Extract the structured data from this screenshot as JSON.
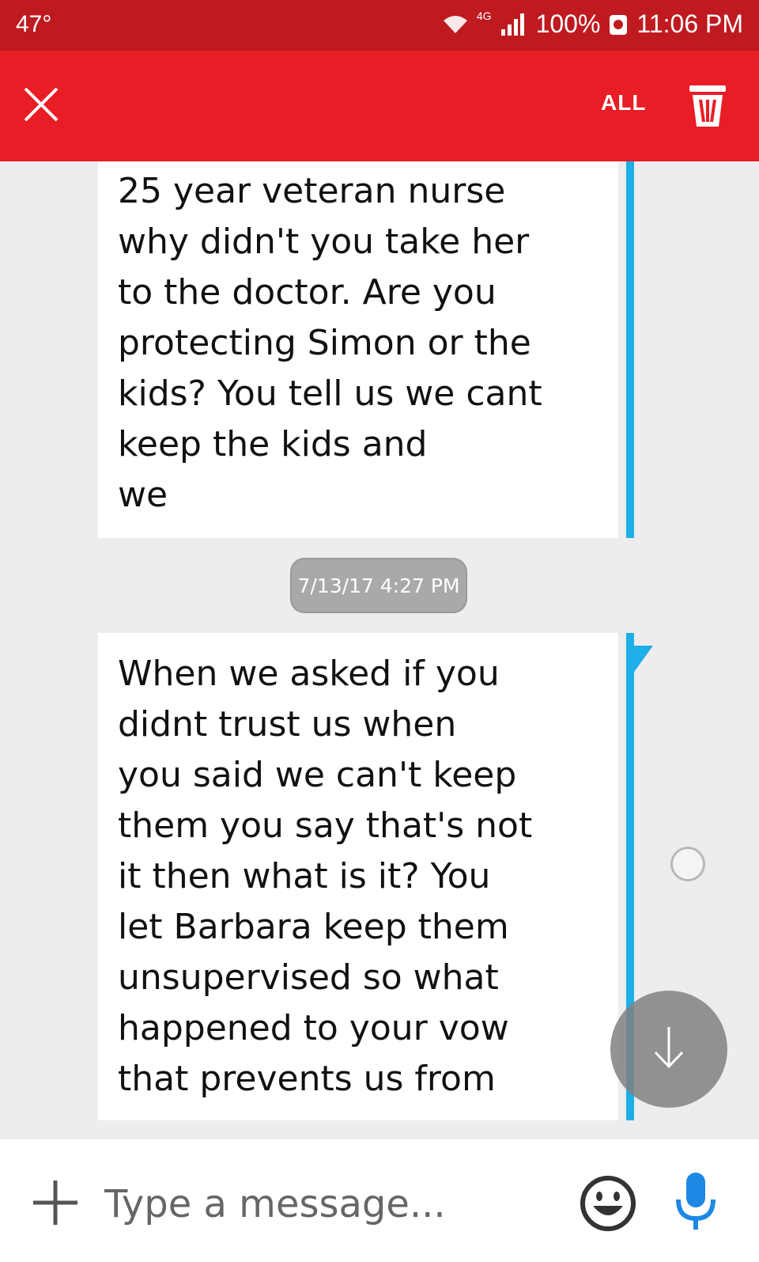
{
  "status_bar": {
    "temperature": "47°",
    "network": "4G",
    "battery": "100%",
    "time": "11:06 PM"
  },
  "toolbar": {
    "close_icon": "close-icon",
    "select_all_label": "ALL",
    "delete_icon": "trash-icon",
    "background": "#e91d25"
  },
  "messages": [
    {
      "text": "25 year veteran nurse\nwhy didn't you take her\nto the doctor. Are you\nprotecting Simon or the\nkids? You tell us we cant\nkeep the kids and\nwe"
    },
    {
      "timestamp": "7/13/17 4:27 PM",
      "text": "When we asked if you\ndidnt trust us when\nyou said we can't keep\nthem you say that's not\nit then what is it? You\nlet Barbara keep them\nunsupervised so what\nhappened to your vow\nthat prevents us from"
    }
  ],
  "composer": {
    "placeholder": "Type a message...",
    "add_icon": "plus-icon",
    "emoji_icon": "emoji-icon",
    "mic_icon": "mic-icon"
  },
  "colors": {
    "accent_blue": "#1eaee8",
    "status_bar": "#bf1a20"
  }
}
